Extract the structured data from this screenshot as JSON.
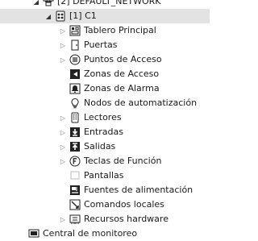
{
  "tree": {
    "network": {
      "label": "[2] DEFAULT_NETWORK"
    },
    "controller": {
      "label": "[1] C1"
    },
    "children": [
      {
        "label": "Tablero Principal",
        "icon": "panel-icon",
        "expandable": true
      },
      {
        "label": "Puertas",
        "icon": "door-icon",
        "expandable": true
      },
      {
        "label": "Puntos de Acceso",
        "icon": "access-point-icon",
        "expandable": true
      },
      {
        "label": "Zonas de Acceso",
        "icon": "access-zone-icon",
        "expandable": false
      },
      {
        "label": "Zonas de Alarma",
        "icon": "alarm-zone-icon",
        "expandable": false
      },
      {
        "label": "Nodos de automatización",
        "icon": "lightbulb-icon",
        "expandable": false
      },
      {
        "label": "Lectores",
        "icon": "reader-icon",
        "expandable": true
      },
      {
        "label": "Entradas",
        "icon": "input-icon",
        "expandable": true
      },
      {
        "label": "Salidas",
        "icon": "output-icon",
        "expandable": true
      },
      {
        "label": "Teclas de Función",
        "icon": "function-key-icon",
        "expandable": true
      },
      {
        "label": "Pantallas",
        "icon": "display-icon",
        "expandable": false
      },
      {
        "label": "Fuentes de alimentación",
        "icon": "power-supply-icon",
        "expandable": false
      },
      {
        "label": "Comandos locales",
        "icon": "local-command-icon",
        "expandable": false
      },
      {
        "label": "Recursos hardware",
        "icon": "hardware-resources-icon",
        "expandable": true
      }
    ],
    "footer": {
      "label": "Central de monitoreo"
    }
  }
}
